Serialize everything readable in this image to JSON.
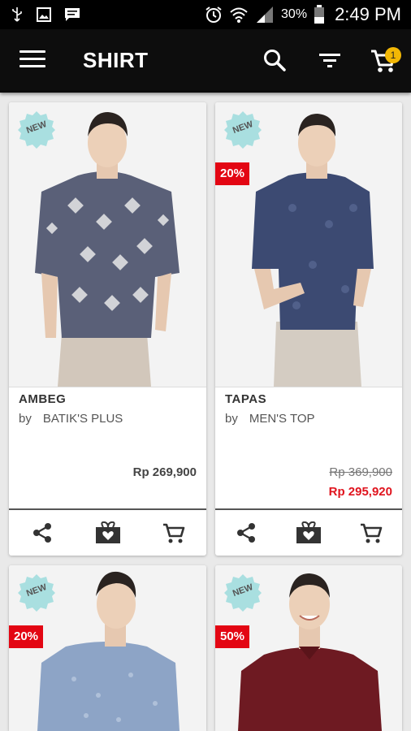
{
  "status_bar": {
    "battery_percent": "30%",
    "time": "2:49 PM",
    "icons": [
      "usb-icon",
      "image-icon",
      "message-icon",
      "alarm-icon",
      "wifi-icon",
      "signal-icon",
      "battery-icon"
    ]
  },
  "app_bar": {
    "title": "SHIRT",
    "cart_count": "1",
    "background": "#0d0d0d",
    "badge_color": "#f2b705"
  },
  "products": [
    {
      "name": "AMBEG",
      "by": "by",
      "brand": "BATIK'S PLUS",
      "badge": "NEW",
      "price": "Rp 269,900",
      "shirt_color": "#5a6078"
    },
    {
      "name": "TAPAS",
      "by": "by",
      "brand": "MEN'S TOP",
      "badge": "NEW",
      "discount": "20%",
      "old_price": "Rp 369,900",
      "price": "Rp 295,920",
      "shirt_color": "#3c4a72"
    },
    {
      "badge": "NEW",
      "discount": "20%",
      "shirt_color": "#8da4c6"
    },
    {
      "badge": "NEW",
      "discount": "50%",
      "shirt_color": "#6e1a22"
    }
  ],
  "colors": {
    "discount_red": "#e30613",
    "sale_price_red": "#e0141e",
    "new_badge": "#a9dfe0"
  }
}
